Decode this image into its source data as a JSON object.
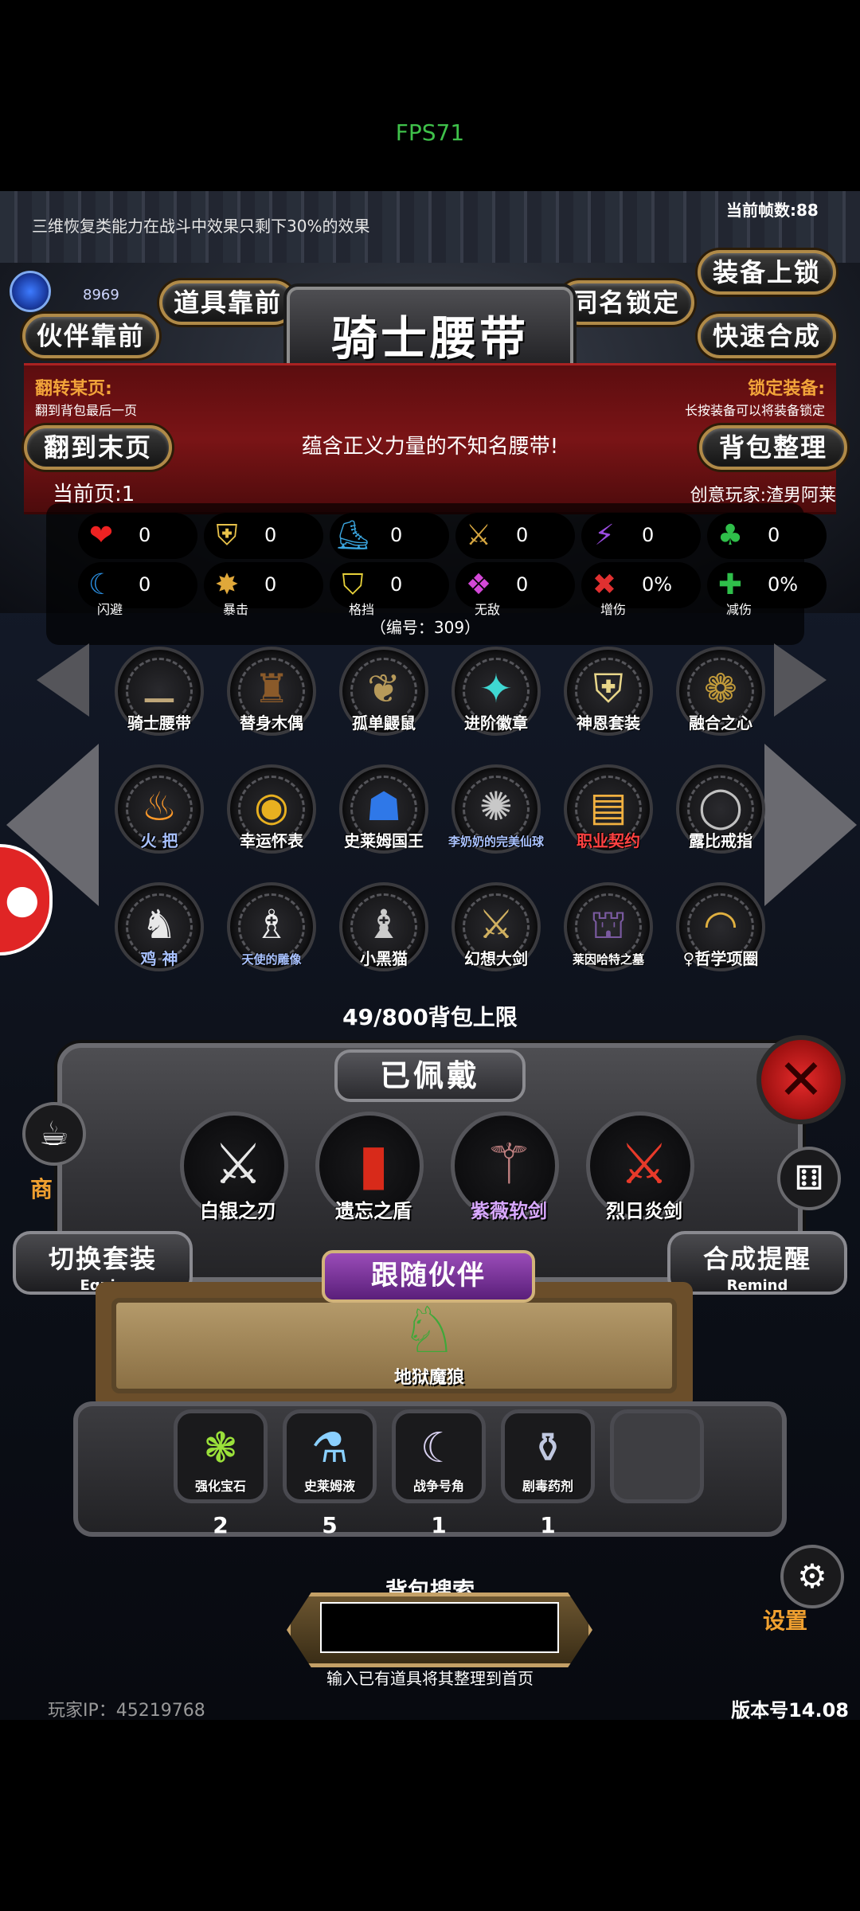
{
  "status": {
    "fps": "FPS71"
  },
  "hud": {
    "notice": "三维恢复类能力在战斗中效果只剩下30%的效果",
    "frame_count": "当前帧数:88",
    "gem_count": "8969"
  },
  "buttons": {
    "props_front": "道具靠前",
    "partner_front": "伙伴靠前",
    "same_name_lock": "同名锁定",
    "equip_lock": "装备上锁",
    "quick_synth": "快速合成",
    "last_page": "翻到末页",
    "bag_sort": "背包整理"
  },
  "item_detail": {
    "title": "骑士腰带",
    "description": "蕴含正义力量的不知名腰带!",
    "serial": "（编号：309）",
    "creator": "创意玩家:渣男阿莱"
  },
  "hints": {
    "flip_title": "翻转某页:",
    "flip_desc": "翻到背包最后一页",
    "lock_title": "锁定装备:",
    "lock_desc": "长按装备可以将装备锁定"
  },
  "page": {
    "current": "当前页:1"
  },
  "stats": [
    {
      "icon": "heart-icon",
      "glyph": "❤",
      "color": "#e22",
      "value": "0",
      "label": ""
    },
    {
      "icon": "armor-icon",
      "glyph": "⛨",
      "color": "#e8c24a",
      "value": "0",
      "label": ""
    },
    {
      "icon": "boot-icon",
      "glyph": "⛸",
      "color": "#3aa6e0",
      "value": "0",
      "label": ""
    },
    {
      "icon": "sword-icon",
      "glyph": "⚔",
      "color": "#d6a640",
      "value": "0",
      "label": ""
    },
    {
      "icon": "lightning-icon",
      "glyph": "⚡",
      "color": "#9b4ce0",
      "value": "0",
      "label": ""
    },
    {
      "icon": "clover-icon",
      "glyph": "♣",
      "color": "#2fbf4a",
      "value": "0",
      "label": ""
    },
    {
      "icon": "dodge-icon",
      "glyph": "☾",
      "color": "#2a8ee0",
      "value": "0",
      "label": "闪避"
    },
    {
      "icon": "crit-icon",
      "glyph": "✸",
      "color": "#e0a83a",
      "value": "0",
      "label": "暴击"
    },
    {
      "icon": "block-icon",
      "glyph": "⛉",
      "color": "#e8d23a",
      "value": "0",
      "label": "格挡"
    },
    {
      "icon": "invincible-icon",
      "glyph": "❖",
      "color": "#d448d8",
      "value": "0",
      "label": "无敌"
    },
    {
      "icon": "damage-up-icon",
      "glyph": "✖",
      "color": "#e03030",
      "value": "0%",
      "label": "增伤"
    },
    {
      "icon": "damage-reduce-icon",
      "glyph": "✚",
      "color": "#2fbf4a",
      "value": "0%",
      "label": "减伤"
    }
  ],
  "items": [
    {
      "name": "骑士腰带",
      "glyph": "⚊",
      "color": "#bfa77a",
      "style": ""
    },
    {
      "name": "替身木偶",
      "glyph": "♜",
      "color": "#8a5a2a",
      "style": ""
    },
    {
      "name": "孤单鼹鼠",
      "glyph": "❦",
      "color": "#b79a5a",
      "style": ""
    },
    {
      "name": "进阶徽章",
      "glyph": "✦",
      "color": "#3fd7d2",
      "style": ""
    },
    {
      "name": "神恩套装",
      "glyph": "⛨",
      "color": "#e8d68a",
      "style": ""
    },
    {
      "name": "融合之心",
      "glyph": "❁",
      "color": "#c19a3a",
      "style": ""
    },
    {
      "name": "火 把",
      "glyph": "♨",
      "color": "#ff9a2a",
      "style": "blue"
    },
    {
      "name": "幸运怀表",
      "glyph": "◉",
      "color": "#e8b020",
      "style": ""
    },
    {
      "name": "史莱姆国王",
      "glyph": "☗",
      "color": "#2f78e8",
      "style": ""
    },
    {
      "name": "李奶奶的完美仙球",
      "glyph": "✺",
      "color": "#c8c8c8",
      "style": "blue small"
    },
    {
      "name": "职业契约",
      "glyph": "▤",
      "color": "#f0b040",
      "style": "red"
    },
    {
      "name": "露比戒指",
      "glyph": "◯",
      "color": "#c0c0c0",
      "style": ""
    },
    {
      "name": "鸡 神",
      "glyph": "♞",
      "color": "#e8e8e8",
      "style": "blue"
    },
    {
      "name": "天使的雕像",
      "glyph": "♗",
      "color": "#f0f0f0",
      "style": "blue small"
    },
    {
      "name": "小黑猫",
      "glyph": "♝",
      "color": "#ccc",
      "style": ""
    },
    {
      "name": "幻想大剑",
      "glyph": "⚔",
      "color": "#d0b060",
      "style": ""
    },
    {
      "name": "莱因哈特之墓",
      "glyph": "⛫",
      "color": "#7a5aa0",
      "style": "small"
    },
    {
      "name": "♀哲学项圈",
      "glyph": "◠",
      "color": "#e0b040",
      "style": ""
    }
  ],
  "bag": {
    "limit": "49/800背包上限"
  },
  "equipped": {
    "title": "已佩戴",
    "items": [
      {
        "name": "白银之刃",
        "glyph": "⚔",
        "color": "#e8e8e8",
        "style": ""
      },
      {
        "name": "遗忘之盾",
        "glyph": "▮",
        "color": "#d82a1a",
        "style": ""
      },
      {
        "name": "紫薇软剑",
        "glyph": "⚚",
        "color": "#c08080",
        "style": "purple"
      },
      {
        "name": "烈日炎剑",
        "glyph": "⚔",
        "color": "#e83a2a",
        "style": ""
      }
    ],
    "switch_set": "切换套装",
    "switch_set_en": "Equip",
    "synth_remind": "合成提醒",
    "synth_remind_en": "Remind"
  },
  "follower": {
    "title": "跟随伙伴",
    "name": "地狱魔狼",
    "glyph": "♘",
    "color": "#3fa83a"
  },
  "consumables": [
    {
      "name": "强化宝石",
      "glyph": "❃",
      "color": "#9ae03a",
      "count": "2"
    },
    {
      "name": "史莱姆液",
      "glyph": "⚗",
      "color": "#8ad0ff",
      "count": "5"
    },
    {
      "name": "战争号角",
      "glyph": "☾",
      "color": "#d8d0f0",
      "count": "1"
    },
    {
      "name": "剧毒药剂",
      "glyph": "⚱",
      "color": "#c0c8e0",
      "count": "1"
    }
  ],
  "search": {
    "label": "背包搜索",
    "value": "",
    "hint": "输入已有道具将其整理到首页"
  },
  "footer": {
    "player_ip": "玩家IP：45219768",
    "version": "版本号14.08"
  },
  "side": {
    "shop": "商",
    "settings": "设置"
  }
}
